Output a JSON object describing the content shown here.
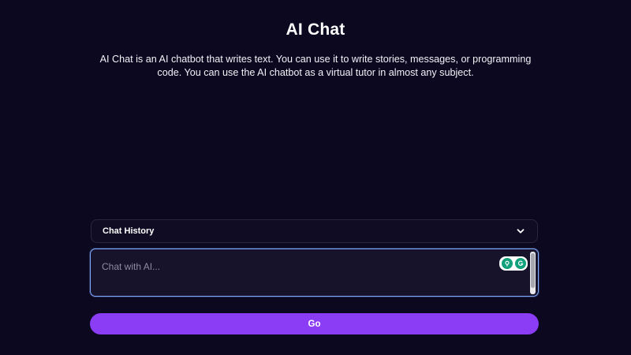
{
  "header": {
    "title": "AI Chat",
    "description": "AI Chat is an AI chatbot that writes text. You can use it to write stories, messages, or programming code. You can use the AI chatbot as a virtual tutor in almost any subject."
  },
  "chat_history": {
    "label": "Chat History",
    "icon": "chevron-down-icon"
  },
  "chat_input": {
    "placeholder": "Chat with AI...",
    "value": ""
  },
  "extension_icons": [
    "location-pin-icon",
    "grammarly-icon"
  ],
  "submit": {
    "label": "Go"
  },
  "colors": {
    "background": "#0b0820",
    "accent": "#8a3df5",
    "input_border": "#7fa8ff"
  }
}
